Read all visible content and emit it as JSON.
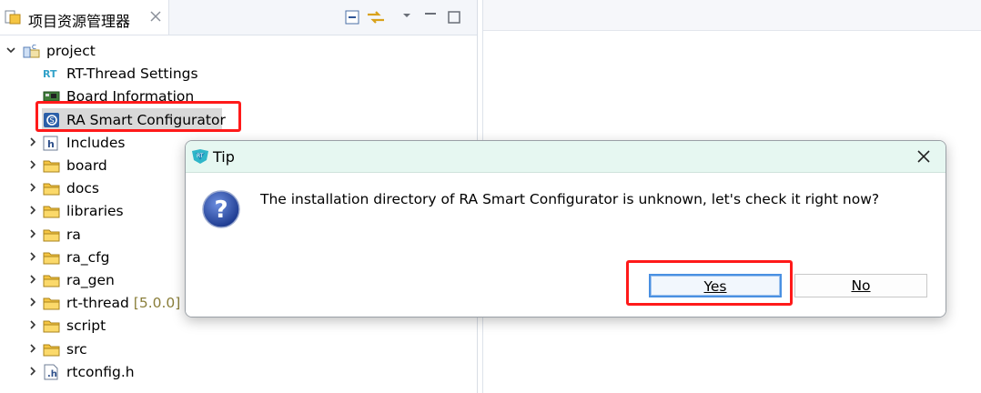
{
  "explorer": {
    "tab_title": "项目资源管理器",
    "tree": [
      {
        "label": "project",
        "version": "",
        "indent": 0,
        "expandable": true,
        "expanded": true,
        "icon": "c-project-icon"
      },
      {
        "label": "RT-Thread Settings",
        "version": "",
        "indent": 1,
        "expandable": false,
        "icon": "rt-settings-icon"
      },
      {
        "label": "Board Information",
        "version": "",
        "indent": 1,
        "expandable": false,
        "icon": "board-info-icon"
      },
      {
        "label": "RA Smart Configurator",
        "version": "",
        "indent": 1,
        "expandable": false,
        "icon": "ra-configurator-icon",
        "selected": true
      },
      {
        "label": "Includes",
        "version": "",
        "indent": 1,
        "expandable": true,
        "icon": "includes-icon"
      },
      {
        "label": "board",
        "version": "",
        "indent": 1,
        "expandable": true,
        "icon": "folder-icon"
      },
      {
        "label": "docs",
        "version": "",
        "indent": 1,
        "expandable": true,
        "icon": "folder-icon"
      },
      {
        "label": "libraries",
        "version": "",
        "indent": 1,
        "expandable": true,
        "icon": "folder-icon"
      },
      {
        "label": "ra",
        "version": "",
        "indent": 1,
        "expandable": true,
        "icon": "folder-icon"
      },
      {
        "label": "ra_cfg",
        "version": "",
        "indent": 1,
        "expandable": true,
        "icon": "folder-icon"
      },
      {
        "label": "ra_gen",
        "version": "",
        "indent": 1,
        "expandable": true,
        "icon": "folder-icon"
      },
      {
        "label": "rt-thread",
        "version": "[5.0.0]",
        "indent": 1,
        "expandable": true,
        "icon": "folder-icon"
      },
      {
        "label": "script",
        "version": "",
        "indent": 1,
        "expandable": true,
        "icon": "folder-icon"
      },
      {
        "label": "src",
        "version": "",
        "indent": 1,
        "expandable": true,
        "icon": "folder-icon"
      },
      {
        "label": "rtconfig.h",
        "version": "",
        "indent": 1,
        "expandable": true,
        "icon": "header-file-icon"
      }
    ]
  },
  "dialog": {
    "title": "Tip",
    "message": "The installation directory of RA Smart Configurator is unknown, let's check it right now?",
    "yes_label": "Yes",
    "no_label": "No"
  },
  "colors": {
    "highlight_red": "#ff1a1a",
    "dialog_title_bg": "#e6f7f1",
    "folder_yellow": "#f5c542",
    "selection_gray": "#d9d9d9"
  }
}
